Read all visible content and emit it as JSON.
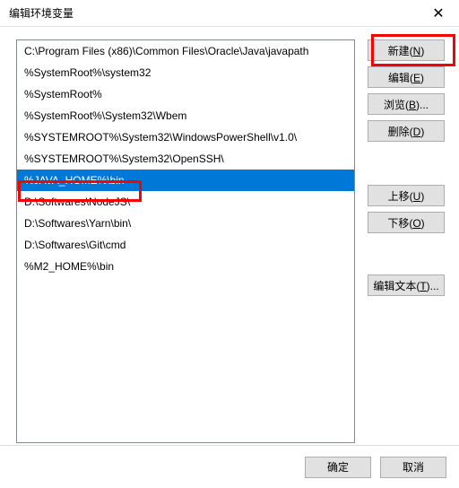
{
  "window": {
    "title": "编辑环境变量"
  },
  "paths": [
    "C:\\Program Files (x86)\\Common Files\\Oracle\\Java\\javapath",
    "%SystemRoot%\\system32",
    "%SystemRoot%",
    "%SystemRoot%\\System32\\Wbem",
    "%SYSTEMROOT%\\System32\\WindowsPowerShell\\v1.0\\",
    "%SYSTEMROOT%\\System32\\OpenSSH\\",
    "%JAVA_HOME%\\bin",
    "D:\\Softwares\\NodeJS\\",
    "D:\\Softwares\\Yarn\\bin\\",
    "D:\\Softwares\\Git\\cmd",
    "%M2_HOME%\\bin"
  ],
  "selected_index": 6,
  "buttons": {
    "new": {
      "text": "新建(",
      "hotkey": "N",
      "suffix": ")"
    },
    "edit": {
      "text": "编辑(",
      "hotkey": "E",
      "suffix": ")"
    },
    "browse": {
      "text": "浏览(",
      "hotkey": "B",
      "suffix": ")..."
    },
    "delete": {
      "text": "删除(",
      "hotkey": "D",
      "suffix": ")"
    },
    "moveup": {
      "text": "上移(",
      "hotkey": "U",
      "suffix": ")"
    },
    "movedown": {
      "text": "下移(",
      "hotkey": "O",
      "suffix": ")"
    },
    "edittext": {
      "text": "编辑文本(",
      "hotkey": "T",
      "suffix": ")..."
    },
    "ok": "确定",
    "cancel": "取消"
  }
}
